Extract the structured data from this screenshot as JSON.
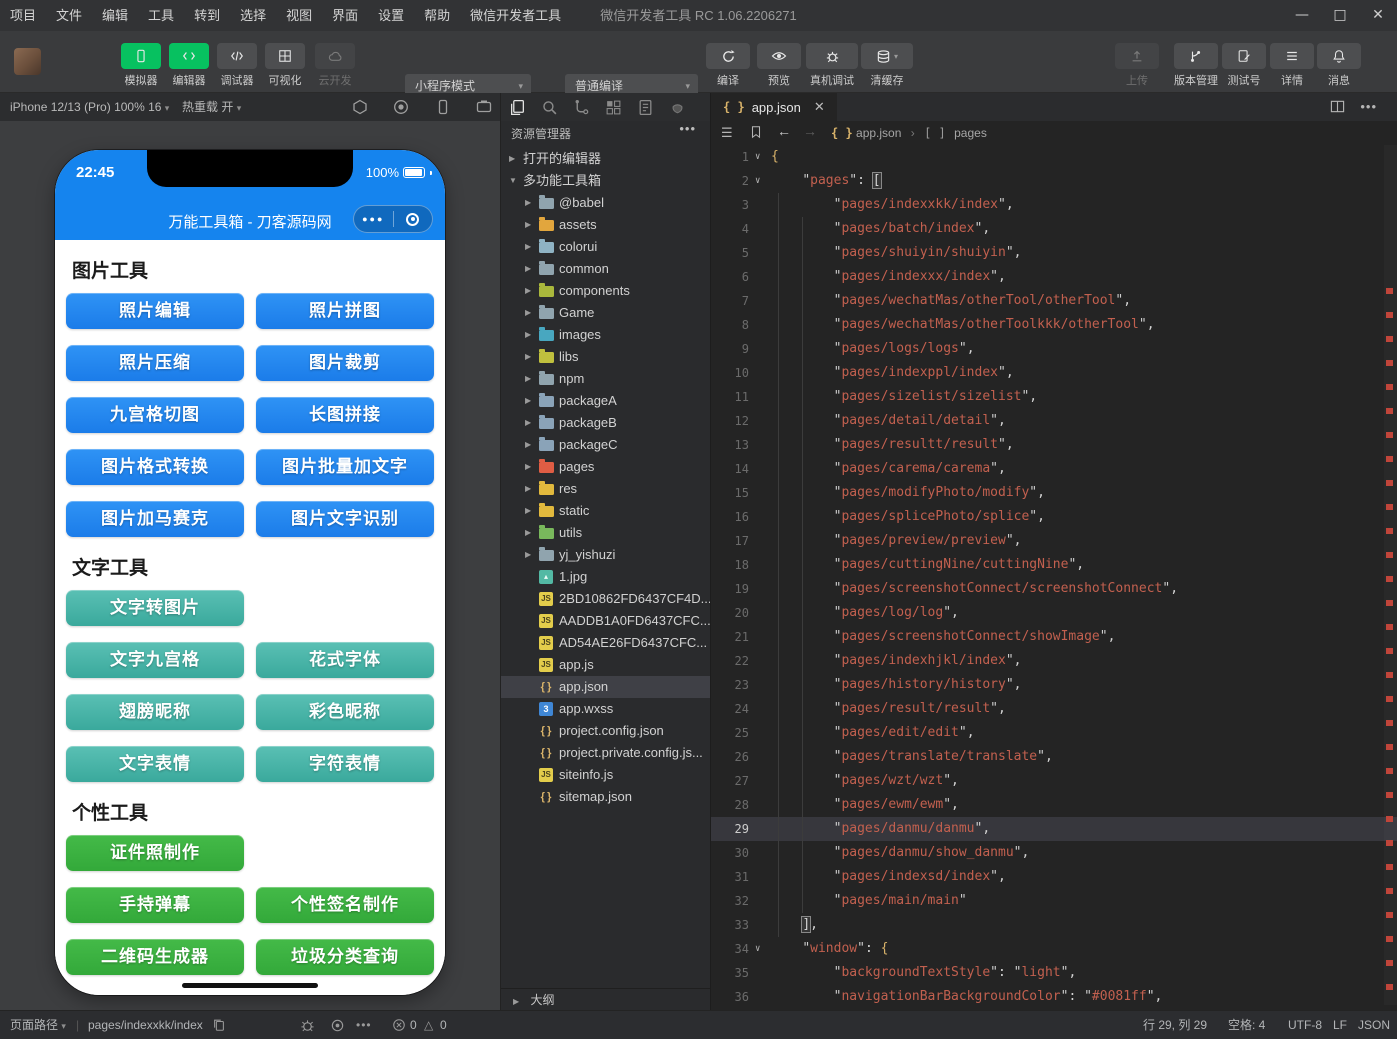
{
  "titlebar": {
    "menus": [
      "项目",
      "文件",
      "编辑",
      "工具",
      "转到",
      "选择",
      "视图",
      "界面",
      "设置",
      "帮助",
      "微信开发者工具"
    ],
    "title": "微信开发者工具 RC 1.06.2206271"
  },
  "toolbar": {
    "left_buttons": [
      {
        "label": "模拟器",
        "icon": "simulator-phone-icon",
        "state": "active"
      },
      {
        "label": "编辑器",
        "icon": "code-icon",
        "state": "active"
      },
      {
        "label": "调试器",
        "icon": "debugger-icon",
        "state": "normal"
      },
      {
        "label": "可视化",
        "icon": "grid-icon",
        "state": "normal"
      },
      {
        "label": "云开发",
        "icon": "cloud-icon",
        "state": "disabled"
      }
    ],
    "mode_select": "小程序模式",
    "compile_select": "普通编译",
    "compile_actions": [
      {
        "label": "编译",
        "icon": "refresh-icon",
        "caret": false
      },
      {
        "label": "预览",
        "icon": "eye-icon",
        "caret": false
      },
      {
        "label": "真机调试",
        "icon": "bug-icon",
        "caret": false
      },
      {
        "label": "清缓存",
        "icon": "layers-icon",
        "caret": true
      }
    ],
    "right_buttons": [
      {
        "label": "上传",
        "icon": "upload-icon",
        "state": "disabled"
      },
      {
        "label": "版本管理",
        "icon": "branch-icon",
        "state": "normal"
      },
      {
        "label": "测试号",
        "icon": "doc-edit-icon",
        "state": "normal"
      },
      {
        "label": "详情",
        "icon": "detail-lines-icon",
        "state": "normal"
      },
      {
        "label": "消息",
        "icon": "bell-icon",
        "state": "normal"
      }
    ]
  },
  "simulator": {
    "device_selector": "iPhone 12/13 (Pro) 100% 16",
    "hot_reload": "热重载 开",
    "phone": {
      "status_time": "22:45",
      "battery_percent": "100%",
      "nav_title": "万能工具箱 - 刀客源码网",
      "sections": [
        {
          "title": "图片工具",
          "color_top": "#2f93f5",
          "color_bottom": "#1b7ce9",
          "rows": [
            [
              "照片编辑",
              "照片拼图"
            ],
            [
              "照片压缩",
              "图片裁剪"
            ],
            [
              "九宫格切图",
              "长图拼接"
            ],
            [
              "图片格式转换",
              "图片批量加文字"
            ],
            [
              "图片加马赛克",
              "图片文字识别"
            ]
          ]
        },
        {
          "title": "文字工具",
          "color_top": "#5ac0b4",
          "color_bottom": "#3aa99c",
          "rows": [
            [
              "文字转图片"
            ],
            [
              "文字九宫格",
              "花式字体"
            ],
            [
              "翅膀昵称",
              "彩色昵称"
            ],
            [
              "文字表情",
              "字符表情"
            ]
          ]
        },
        {
          "title": "个性工具",
          "color_top": "#44ba48",
          "color_bottom": "#33a93a",
          "rows": [
            [
              "证件照制作"
            ],
            [
              "手持弹幕",
              "个性签名制作"
            ],
            [
              "二维码生成器",
              "垃圾分类查询"
            ]
          ]
        }
      ]
    }
  },
  "explorer": {
    "title": "资源管理器",
    "sections": [
      {
        "label": "打开的编辑器",
        "expanded": false
      },
      {
        "label": "多功能工具箱",
        "expanded": true
      }
    ],
    "tree": [
      {
        "name": "@babel",
        "kind": "folder",
        "color": "#90a4ae"
      },
      {
        "name": "assets",
        "kind": "folder",
        "color": "#e2a63d"
      },
      {
        "name": "colorui",
        "kind": "folder",
        "color": "#8fb3c4"
      },
      {
        "name": "common",
        "kind": "folder",
        "color": "#90a4ae"
      },
      {
        "name": "components",
        "kind": "folder",
        "color": "#aab83c"
      },
      {
        "name": "Game",
        "kind": "folder",
        "color": "#90a4ae"
      },
      {
        "name": "images",
        "kind": "folder",
        "color": "#48a7c0"
      },
      {
        "name": "libs",
        "kind": "folder",
        "color": "#c0c03e"
      },
      {
        "name": "npm",
        "kind": "folder",
        "color": "#90a4ae"
      },
      {
        "name": "packageA",
        "kind": "folder",
        "color": "#8aa3b8"
      },
      {
        "name": "packageB",
        "kind": "folder",
        "color": "#8aa3b8"
      },
      {
        "name": "packageC",
        "kind": "folder",
        "color": "#8aa3b8"
      },
      {
        "name": "pages",
        "kind": "folder",
        "color": "#e05d44"
      },
      {
        "name": "res",
        "kind": "folder",
        "color": "#e2b93d"
      },
      {
        "name": "static",
        "kind": "folder",
        "color": "#e2b93d"
      },
      {
        "name": "utils",
        "kind": "folder",
        "color": "#79b85c"
      },
      {
        "name": "yj_yishuzi",
        "kind": "folder",
        "color": "#90a4ae"
      },
      {
        "name": "1.jpg",
        "kind": "img"
      },
      {
        "name": "2BD10862FD6437CF4D...",
        "kind": "js"
      },
      {
        "name": "AADDB1A0FD6437CFC...",
        "kind": "js"
      },
      {
        "name": "AD54AE26FD6437CFC...",
        "kind": "js"
      },
      {
        "name": "app.js",
        "kind": "js"
      },
      {
        "name": "app.json",
        "kind": "json",
        "selected": true
      },
      {
        "name": "app.wxss",
        "kind": "wxss"
      },
      {
        "name": "project.config.json",
        "kind": "json"
      },
      {
        "name": "project.private.config.js...",
        "kind": "json"
      },
      {
        "name": "siteinfo.js",
        "kind": "js"
      },
      {
        "name": "sitemap.json",
        "kind": "json"
      }
    ],
    "outline_label": "大纲"
  },
  "editor": {
    "tab": "app.json",
    "breadcrumb": {
      "file": "app.json",
      "node": "pages"
    },
    "active_line": 29,
    "fold_lines": [
      1,
      2,
      34
    ],
    "matched_bracket_lines": [
      2,
      33
    ],
    "lines": [
      "{",
      "    \"pages\": [",
      "        \"pages/indexxkk/index\",",
      "        \"pages/batch/index\",",
      "        \"pages/shuiyin/shuiyin\",",
      "        \"pages/indexxx/index\",",
      "        \"pages/wechatMas/otherTool/otherTool\",",
      "        \"pages/wechatMas/otherToolkkk/otherTool\",",
      "        \"pages/logs/logs\",",
      "        \"pages/indexppl/index\",",
      "        \"pages/sizelist/sizelist\",",
      "        \"pages/detail/detail\",",
      "        \"pages/resultt/result\",",
      "        \"pages/carema/carema\",",
      "        \"pages/modifyPhoto/modify\",",
      "        \"pages/splicePhoto/splice\",",
      "        \"pages/preview/preview\",",
      "        \"pages/cuttingNine/cuttingNine\",",
      "        \"pages/screenshotConnect/screenshotConnect\",",
      "        \"pages/log/log\",",
      "        \"pages/screenshotConnect/showImage\",",
      "        \"pages/indexhjkl/index\",",
      "        \"pages/history/history\",",
      "        \"pages/result/result\",",
      "        \"pages/edit/edit\",",
      "        \"pages/translate/translate\",",
      "        \"pages/wzt/wzt\",",
      "        \"pages/ewm/ewm\",",
      "        \"pages/danmu/danmu\",",
      "        \"pages/danmu/show_danmu\",",
      "        \"pages/indexsd/index\",",
      "        \"pages/main/main\"",
      "    ],",
      "    \"window\": {",
      "        \"backgroundTextStyle\": \"light\",",
      "        \"navigationBarBackgroundColor\": \"#0081ff\","
    ]
  },
  "statusbar": {
    "left_label": "页面路径",
    "page_path": "pages/indexxkk/index",
    "error_count": "0",
    "warning_count": "0",
    "cursor": "行 29, 列 29",
    "indent": "空格: 4",
    "encoding": "UTF-8",
    "eol": "LF",
    "language": "JSON"
  },
  "colors": {
    "accent_green": "#07c160",
    "nav_blue": "#1584ee",
    "string_red": "#c2604f",
    "brace_yellow": "#d9b36a"
  }
}
